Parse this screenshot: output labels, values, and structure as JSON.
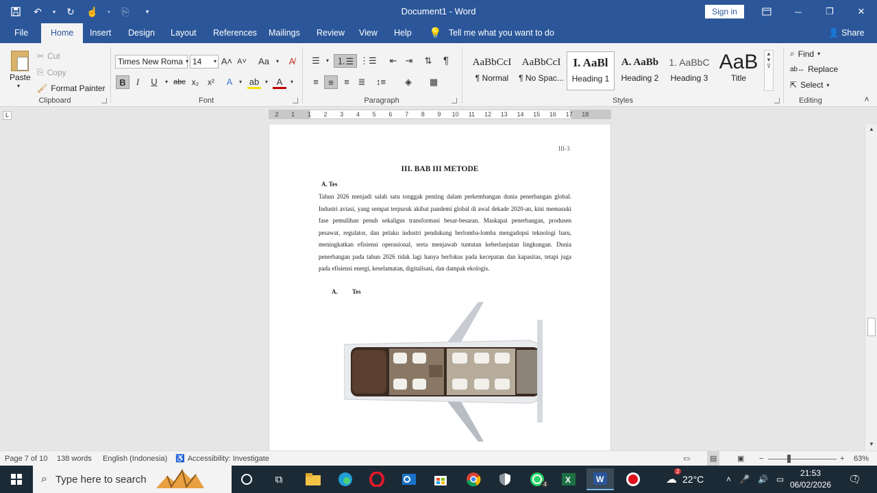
{
  "window": {
    "doc_title": "Document1  -  Word",
    "sign_in": "Sign in"
  },
  "tabs": [
    {
      "label": "File"
    },
    {
      "label": "Home"
    },
    {
      "label": "Insert"
    },
    {
      "label": "Design"
    },
    {
      "label": "Layout"
    },
    {
      "label": "References"
    },
    {
      "label": "Mailings"
    },
    {
      "label": "Review"
    },
    {
      "label": "View"
    },
    {
      "label": "Help"
    }
  ],
  "tell_me": "Tell me what you want to do",
  "share": "Share",
  "clipboard": {
    "paste": "Paste",
    "cut": "Cut",
    "copy": "Copy",
    "format_painter": "Format Painter",
    "label": "Clipboard"
  },
  "font": {
    "name": "Times New Roma",
    "size": "14",
    "label": "Font",
    "case_label": "Aa"
  },
  "paragraph": {
    "label": "Paragraph"
  },
  "styles": {
    "label": "Styles",
    "items": [
      {
        "preview": "AaBbCcI",
        "name": "¶ Normal"
      },
      {
        "preview": "AaBbCcI",
        "name": "¶ No Spac..."
      },
      {
        "preview": "I.  AaBl",
        "name": "Heading 1"
      },
      {
        "preview": "A.  AaBb",
        "name": "Heading 2"
      },
      {
        "preview": "1.  AaBbC",
        "name": "Heading 3"
      },
      {
        "preview": "AaB",
        "name": "Title"
      }
    ]
  },
  "editing": {
    "find": "Find",
    "replace": "Replace",
    "select": "Select",
    "label": "Editing"
  },
  "ruler_ticks": [
    "2",
    "1",
    "1",
    "2",
    "3",
    "4",
    "5",
    "6",
    "7",
    "8",
    "9",
    "10",
    "11",
    "12",
    "13",
    "14",
    "15",
    "16",
    "17",
    "18"
  ],
  "document": {
    "page_number": "III-3",
    "heading": "III.     BAB III METODE",
    "sub1": "A.  Tes",
    "body": "Tahun 2026 menjadi salah satu tonggak penting dalam perkembangan dunia penerbangan global. Industri aviasi, yang sempat terpuruk akibat pandemi global di awal dekade 2020-an, kini memasuki fase pemulihan penuh sekaligus transformasi besar-besaran. Maskapai penerbangan, produsen pesawat, regulator, dan pelaku industri pendukung berlomba-lomba mengadopsi teknologi baru, meningkatkan efisiensi operasional, serta menjawab tuntutan keberlanjutan lingkungan. Dunia penerbangan pada tahun 2026 tidak lagi hanya berfokus pada kecepatan dan kapasitas, tetapi juga pada efisiensi energi, keselamatan, digitalisasi, dan dampak ekologis.",
    "sub2_letter": "A.",
    "sub2_text": "Tes"
  },
  "status": {
    "page": "Page 7 of 10",
    "words": "138 words",
    "language": "English (Indonesia)",
    "accessibility": "Accessibility: Investigate",
    "zoom": "63%",
    "zoom_level": 0.63
  },
  "taskbar": {
    "search_placeholder": "Type here to search",
    "weather": "22°C",
    "weather_badge": "2",
    "whatsapp_badge": "4",
    "time": "21:53",
    "date": "06/02/2026",
    "notif_badge": "7"
  }
}
